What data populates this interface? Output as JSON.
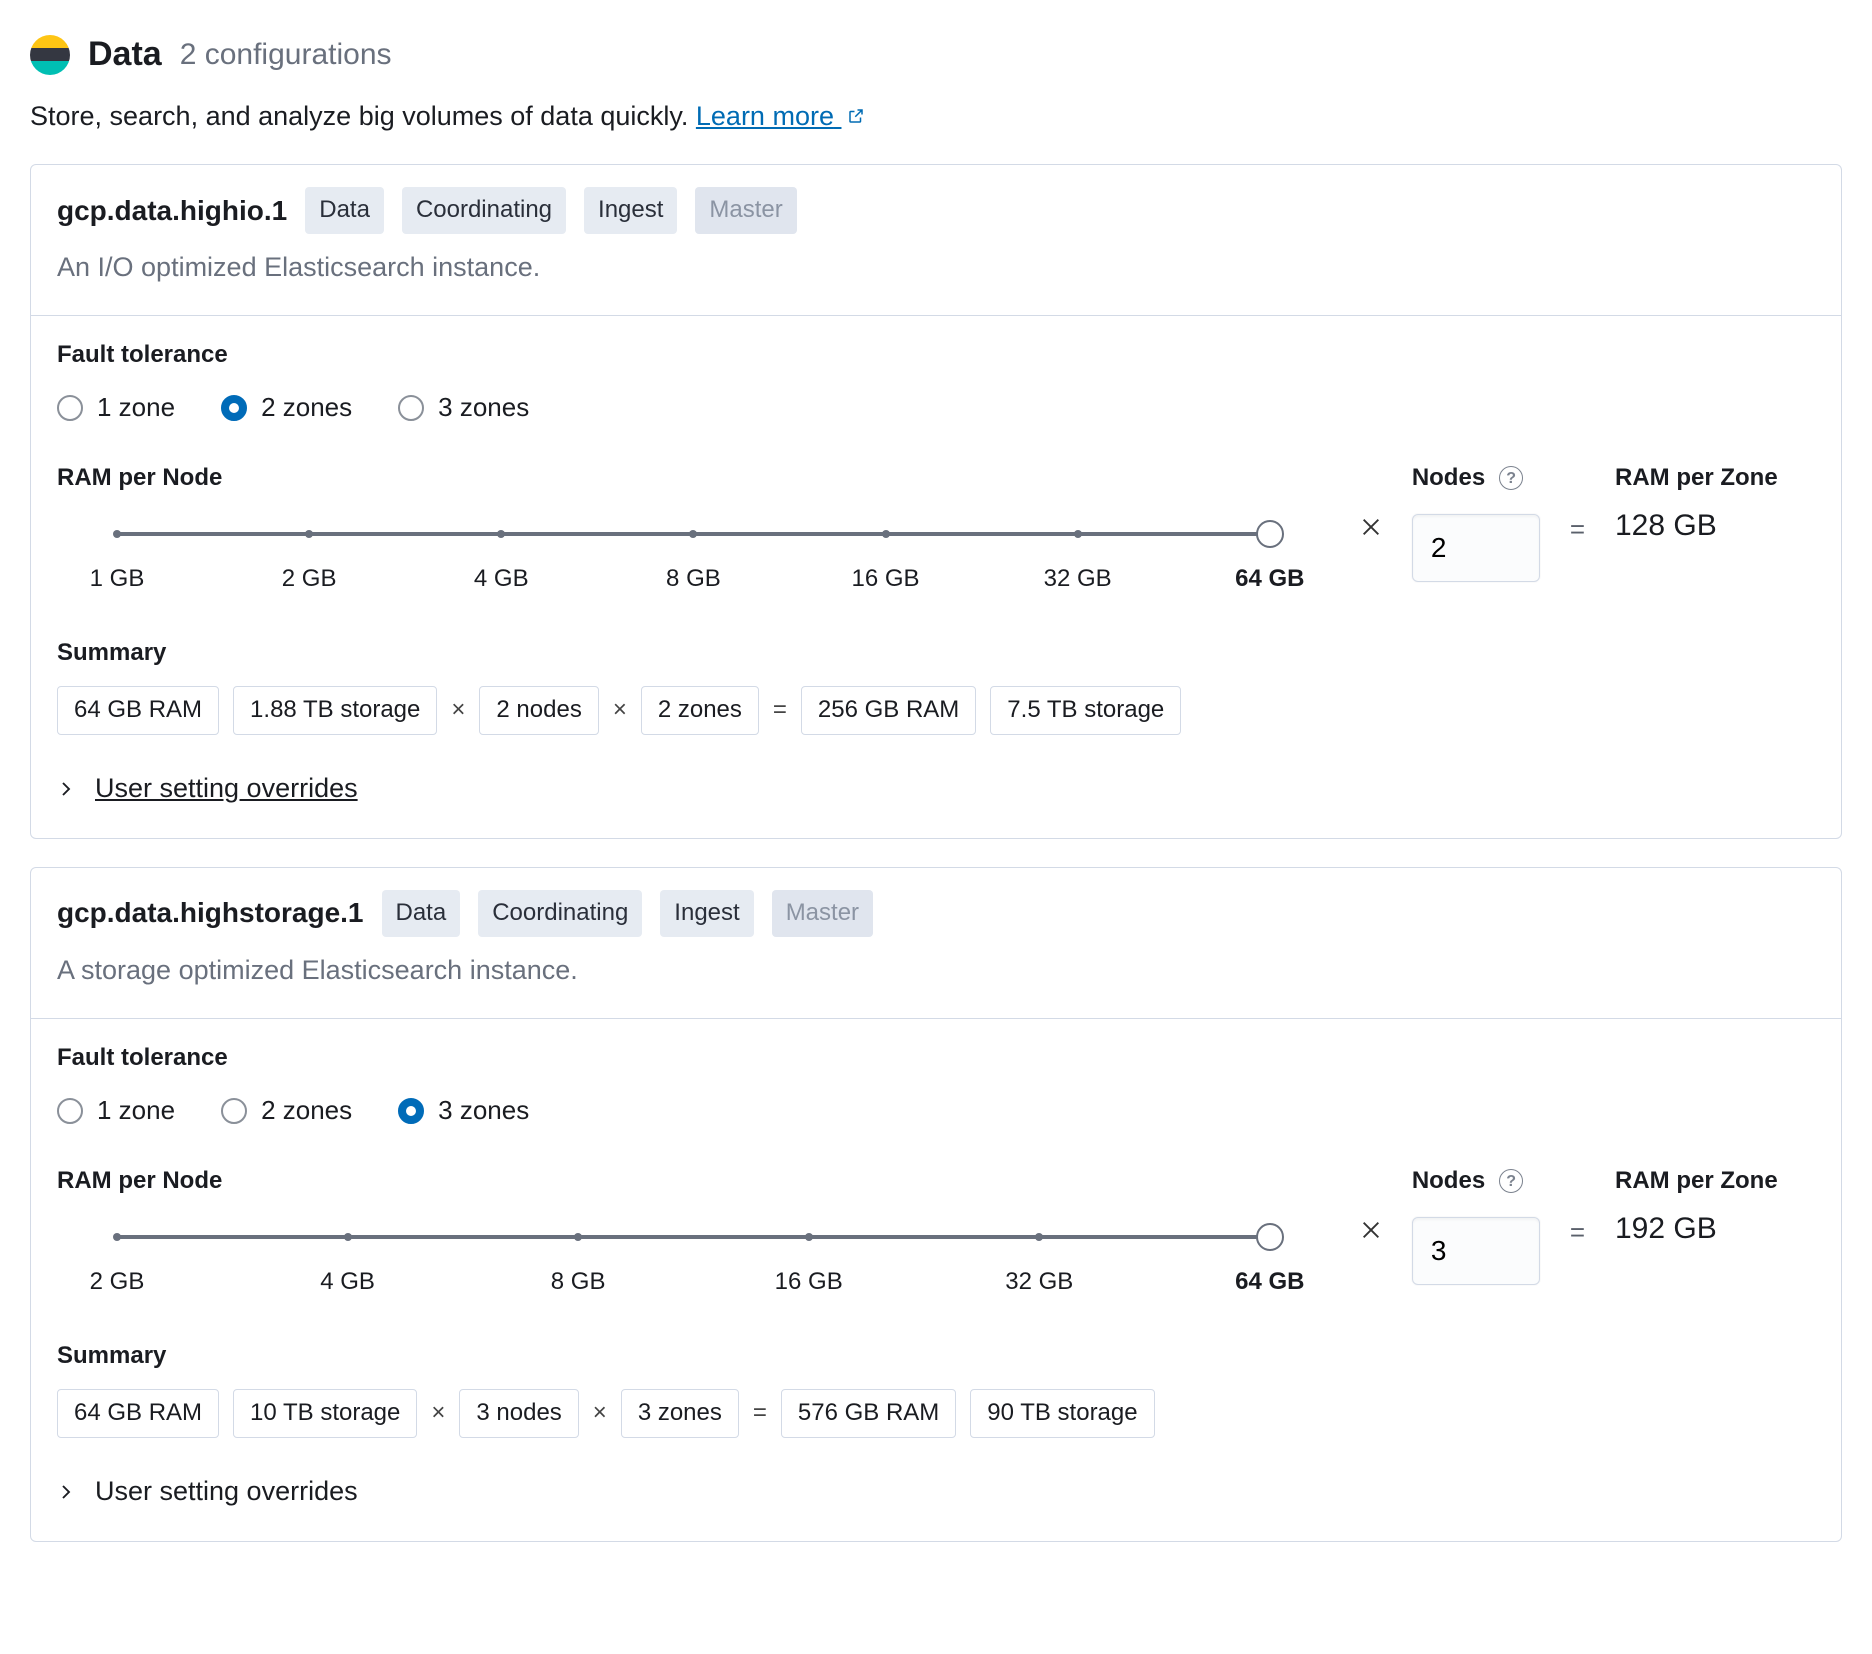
{
  "header": {
    "title": "Data",
    "config_count": "2 configurations",
    "description": "Store, search, and analyze big volumes of data quickly.",
    "learn_more": "Learn more"
  },
  "labels": {
    "fault_tolerance": "Fault tolerance",
    "ram_per_node": "RAM per Node",
    "nodes": "Nodes",
    "ram_per_zone": "RAM per Zone",
    "summary": "Summary",
    "user_overrides": "User setting overrides",
    "times": "×",
    "equals": "="
  },
  "roles": [
    "Data",
    "Coordinating",
    "Ingest",
    "Master"
  ],
  "zone_options": [
    "1 zone",
    "2 zones",
    "3 zones"
  ],
  "instances": [
    {
      "name": "gcp.data.highio.1",
      "desc": "An I/O optimized Elasticsearch instance.",
      "disabled_roles": [
        "Master"
      ],
      "fault_selected": 1,
      "slider": {
        "labels": [
          "1 GB",
          "2 GB",
          "4 GB",
          "8 GB",
          "16 GB",
          "32 GB",
          "64 GB"
        ],
        "selected_index": 6
      },
      "nodes_value": "2",
      "ram_per_zone": "128 GB",
      "summary": {
        "ram": "64 GB RAM",
        "storage": "1.88 TB storage",
        "nodes": "2 nodes",
        "zones": "2 zones",
        "total_ram": "256 GB RAM",
        "total_storage": "7.5 TB storage"
      },
      "overrides_underlined": true
    },
    {
      "name": "gcp.data.highstorage.1",
      "desc": "A storage optimized Elasticsearch instance.",
      "disabled_roles": [
        "Master"
      ],
      "fault_selected": 2,
      "slider": {
        "labels": [
          "2 GB",
          "4 GB",
          "8 GB",
          "16 GB",
          "32 GB",
          "64 GB"
        ],
        "selected_index": 5
      },
      "nodes_value": "3",
      "ram_per_zone": "192 GB",
      "summary": {
        "ram": "64 GB RAM",
        "storage": "10 TB storage",
        "nodes": "3 nodes",
        "zones": "3 zones",
        "total_ram": "576 GB RAM",
        "total_storage": "90 TB storage"
      },
      "overrides_underlined": false
    }
  ]
}
